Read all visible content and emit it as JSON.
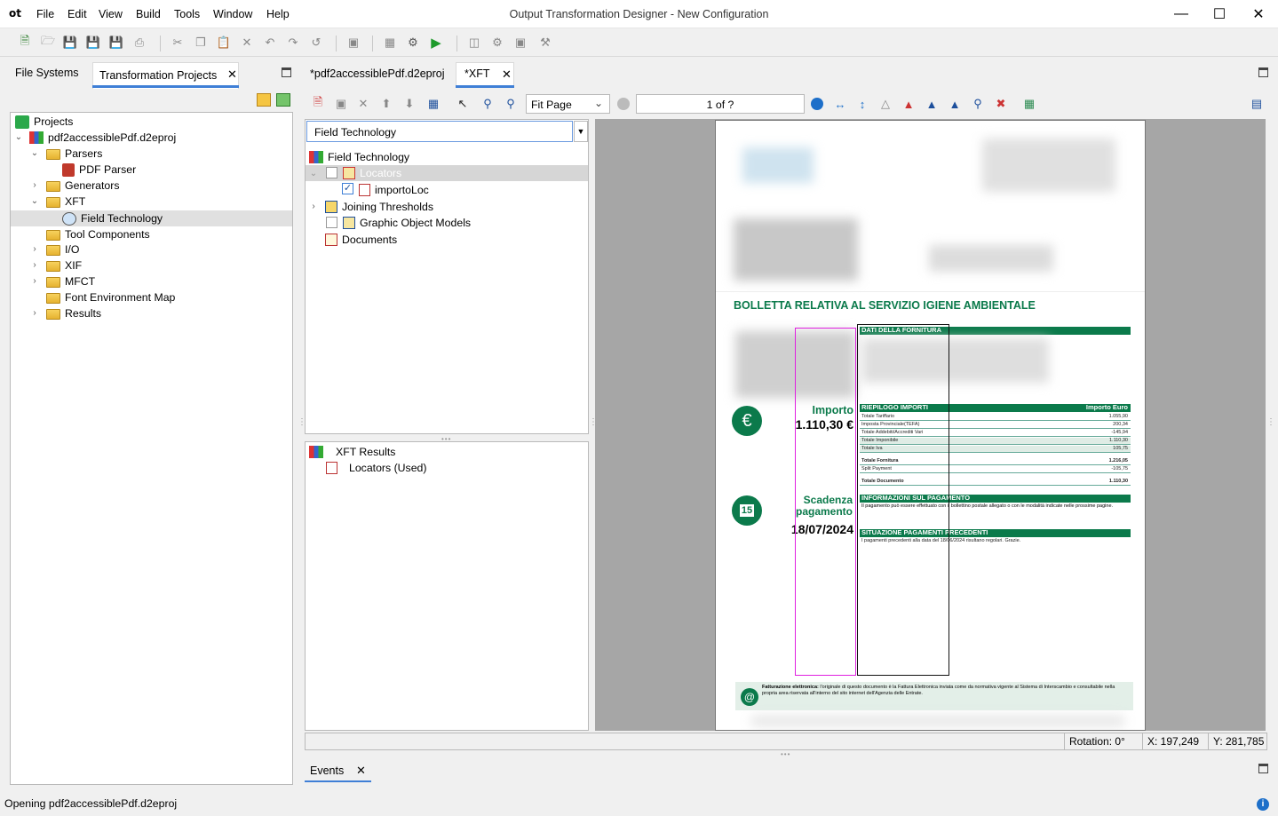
{
  "app": {
    "logo": "ot",
    "title": "Output Transformation Designer - New Configuration",
    "menu": [
      "File",
      "Edit",
      "View",
      "Build",
      "Tools",
      "Window",
      "Help"
    ]
  },
  "left_panel": {
    "tabs": [
      "File Systems",
      "Transformation Projects"
    ],
    "tree": [
      {
        "label": "Projects"
      },
      {
        "label": "pdf2accessiblePdf.d2eproj"
      },
      {
        "label": "Parsers"
      },
      {
        "label": "PDF Parser"
      },
      {
        "label": "Generators"
      },
      {
        "label": "XFT"
      },
      {
        "label": "Field Technology"
      },
      {
        "label": "Tool Components"
      },
      {
        "label": "I/O"
      },
      {
        "label": "XIF"
      },
      {
        "label": "MFCT"
      },
      {
        "label": "Font Environment Map"
      },
      {
        "label": "Results"
      }
    ]
  },
  "editor_tabs": [
    "*pdf2accessiblePdf.d2eproj",
    "*XFT"
  ],
  "viewer_toolbar": {
    "zoom": "Fit Page",
    "page": "1 of ?"
  },
  "center": {
    "selector": "Field Technology",
    "tree": [
      {
        "label": "Field Technology"
      },
      {
        "label": "Locators"
      },
      {
        "label": "importoLoc"
      },
      {
        "label": "Joining Thresholds"
      },
      {
        "label": "Graphic Object Models"
      },
      {
        "label": "Documents"
      }
    ],
    "results": [
      {
        "label": "XFT Results"
      },
      {
        "label": "Locators (Used)"
      }
    ]
  },
  "document": {
    "heading": "BOLLETTA RELATIVA AL SERVIZIO IGIENE AMBIENTALE",
    "dati": "DATI DELLA FORNITURA",
    "riepilogo": "RIEPILOGO IMPORTI",
    "importo_euro": "Importo Euro",
    "rows": [
      {
        "label": "Totale Tariffario",
        "value": "1.055,90"
      },
      {
        "label": "Imposta Provinciale(TEFA)",
        "value": "200,34"
      },
      {
        "label": "Totale Addebiti/Accrediti Vari",
        "value": "-145,94"
      },
      {
        "label": "Totale Imponibile",
        "value": "1.110,30"
      },
      {
        "label": "Totale Iva",
        "value": "105,75"
      },
      {
        "label": "Totale Fornitura",
        "value": "1.216,05"
      },
      {
        "label": "Split Payment",
        "value": "-105,75"
      },
      {
        "label": "Totale Documento",
        "value": "1.110,30"
      }
    ],
    "importo_label": "Importo",
    "importo_value": "1.110,30 €",
    "scadenza_label1": "Scadenza",
    "scadenza_label2": "pagamento",
    "scadenza_value": "18/07/2024",
    "calendar_day": "15",
    "info_title": "INFORMAZIONI SUL PAGAMENTO",
    "info_text": "Il pagamento può essere effettuato con il bollettino postale allegato o con le modalità indicate nelle prossime pagine.",
    "situazione_title": "SITUAZIONE PAGAMENTI PRECEDENTI",
    "situazione_text": "I pagamenti precedenti alla data del 18/06/2024 risultano regolari.  Grazie.",
    "fattura_bold": "Fatturazione elettronica:",
    "fattura_text": "l'originale di questo documento è la Fattura Elettronica inviata come da normativa vigente al Sistema di Interscambio e consultabile nella propria area riservata all'interno del sito internet dell'Agenzia delle Entrate."
  },
  "status": {
    "rotation": "Rotation: 0°",
    "x": "X: 197,249",
    "y": "Y: 281,785"
  },
  "events_tab": "Events",
  "statusbar": "Opening pdf2accessiblePdf.d2eproj",
  "colors": {
    "green": "#0b7a4b",
    "magenta": "#e020e0",
    "selection": "#e0e0e0"
  }
}
